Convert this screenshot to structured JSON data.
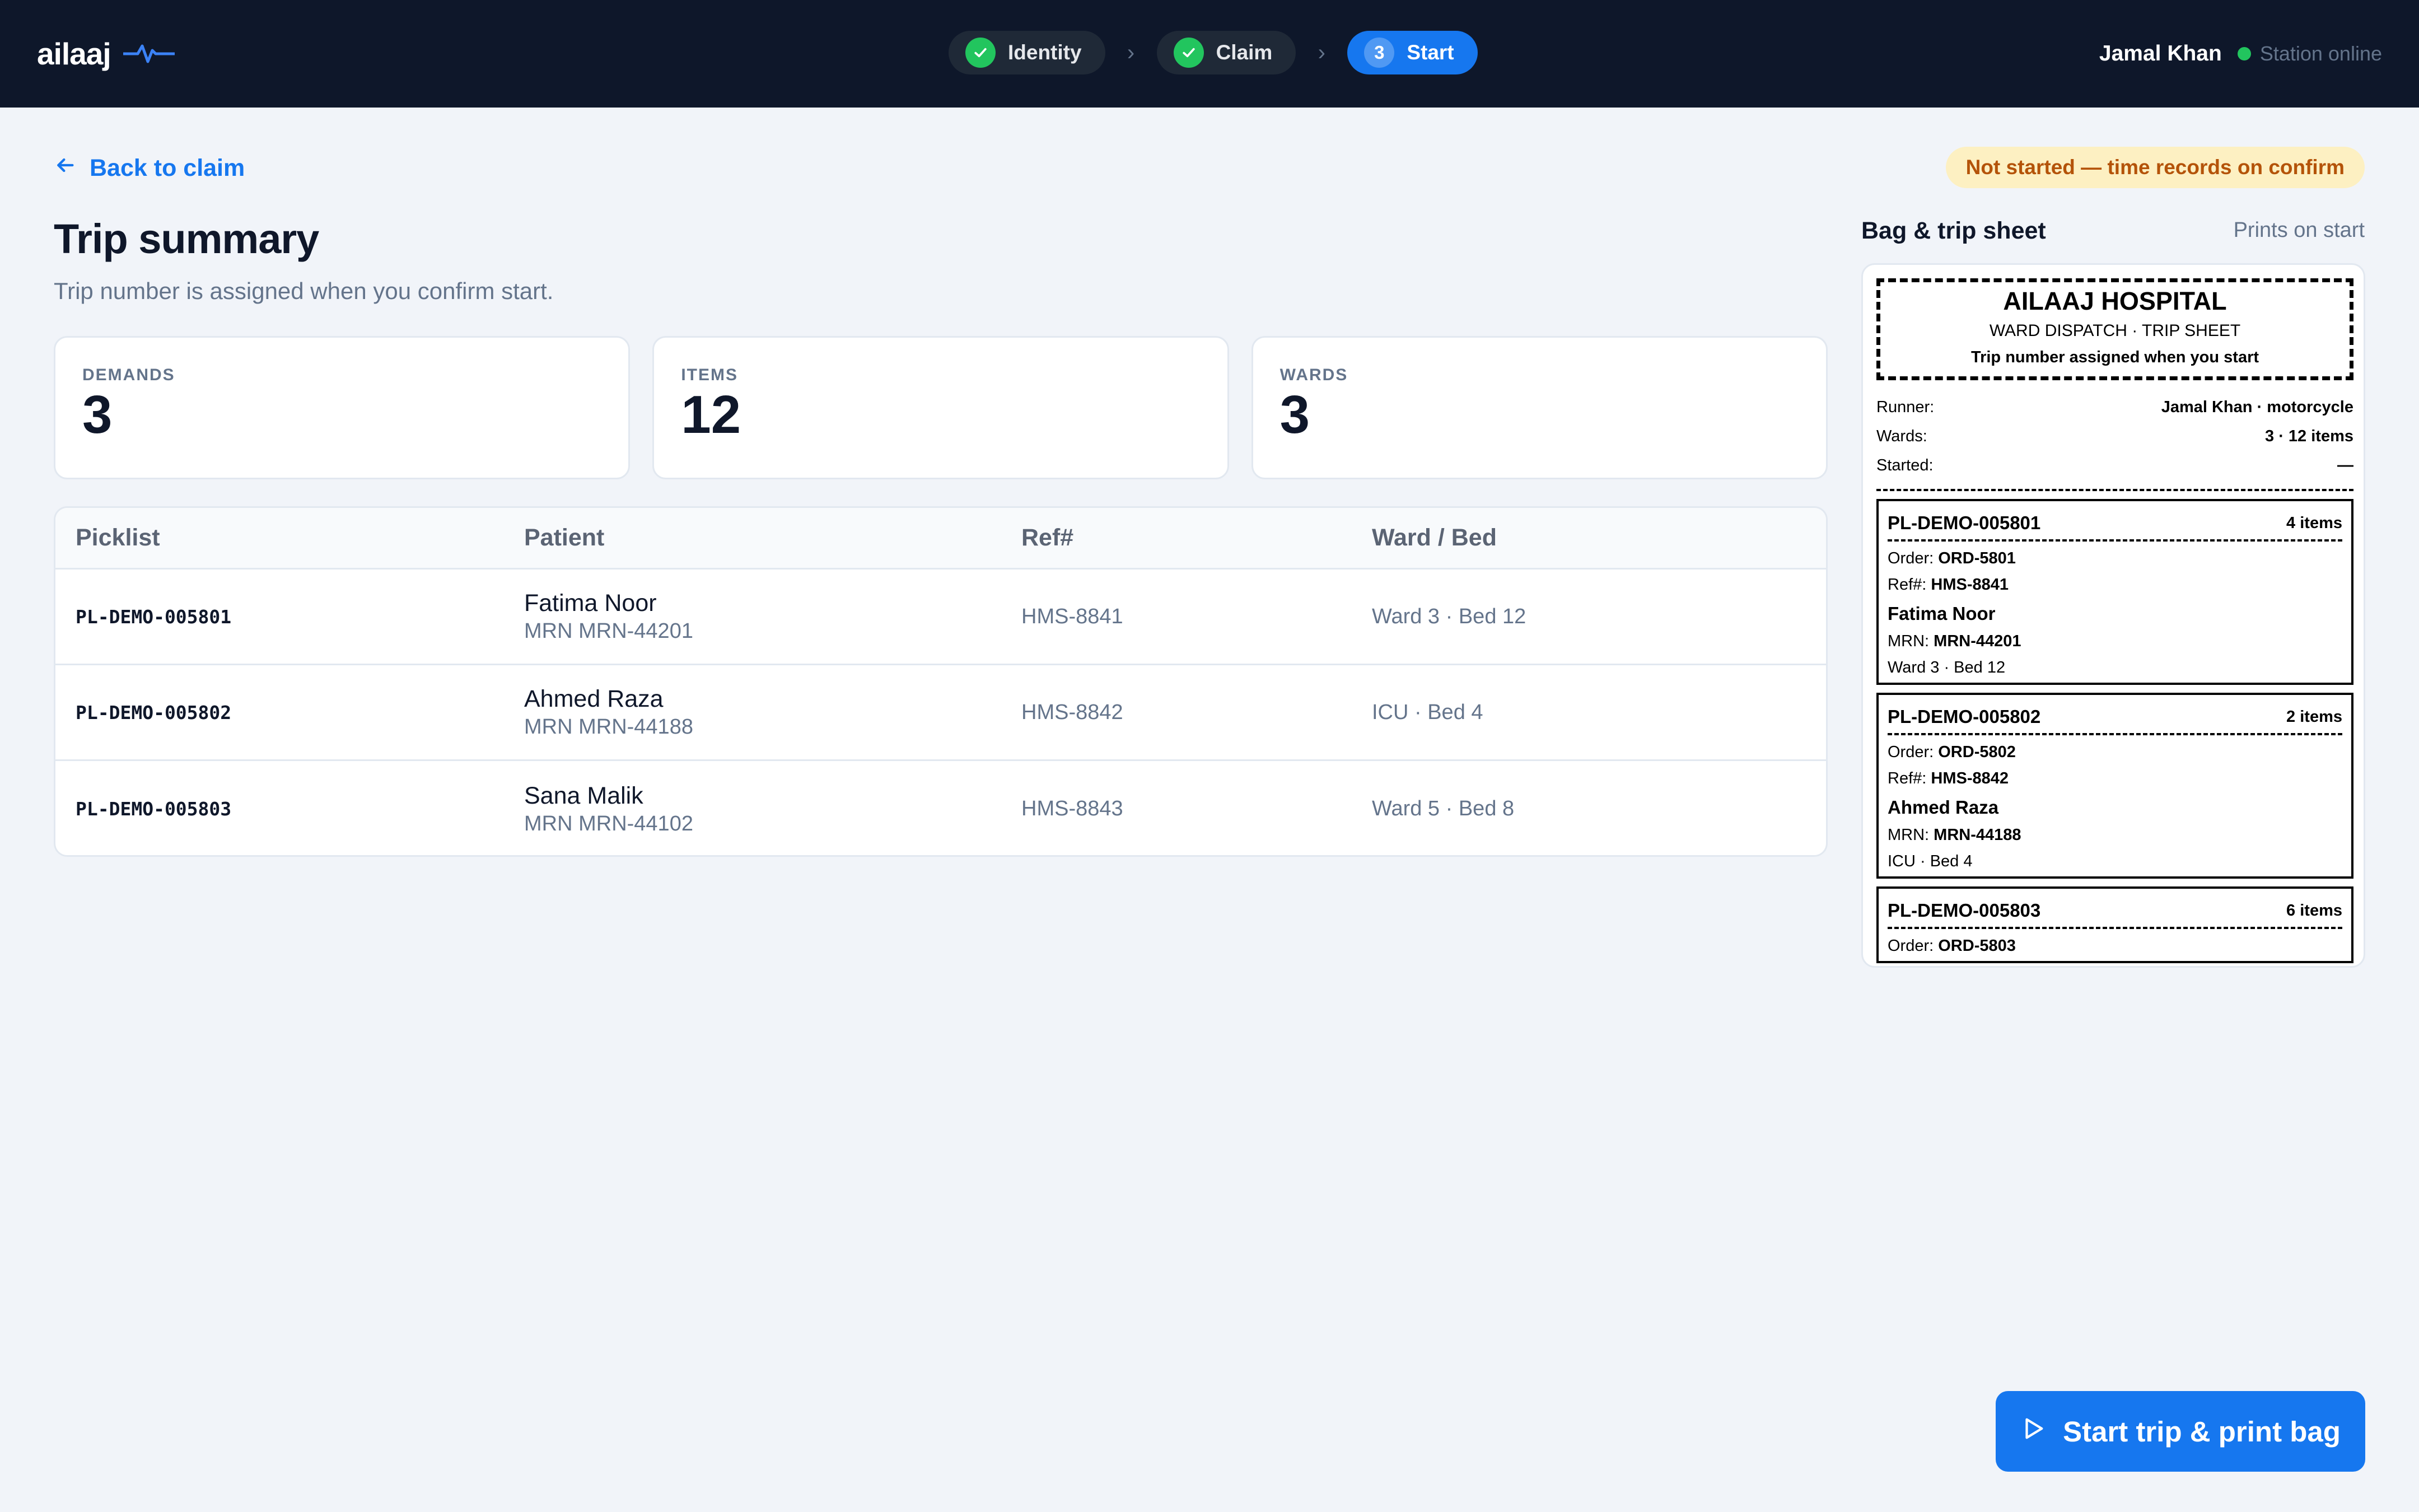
{
  "app": {
    "brand": "ailaaj"
  },
  "stepper": {
    "steps": [
      {
        "label": "Identity",
        "state": "done"
      },
      {
        "label": "Claim",
        "state": "done"
      },
      {
        "label": "Start",
        "state": "active",
        "number": "3"
      }
    ]
  },
  "user": {
    "name": "Jamal Khan",
    "station_status": "Station online"
  },
  "nav": {
    "back_label": "Back to claim"
  },
  "status_badge": "Not started — time records on confirm",
  "page": {
    "title": "Trip summary",
    "subtitle": "Trip number is assigned when you confirm start."
  },
  "stats": [
    {
      "label": "DEMANDS",
      "value": "3"
    },
    {
      "label": "ITEMS",
      "value": "12"
    },
    {
      "label": "WARDS",
      "value": "3"
    }
  ],
  "table": {
    "headers": [
      "Picklist",
      "Patient",
      "Ref#",
      "Ward / Bed"
    ],
    "rows": [
      {
        "picklist": "PL-DEMO-005801",
        "patient": "Fatima Noor",
        "mrn": "MRN MRN-44201",
        "ref": "HMS-8841",
        "ward": "Ward 3 · Bed 12"
      },
      {
        "picklist": "PL-DEMO-005802",
        "patient": "Ahmed Raza",
        "mrn": "MRN MRN-44188",
        "ref": "HMS-8842",
        "ward": "ICU · Bed 4"
      },
      {
        "picklist": "PL-DEMO-005803",
        "patient": "Sana Malik",
        "mrn": "MRN MRN-44102",
        "ref": "HMS-8843",
        "ward": "Ward 5 · Bed 8"
      }
    ]
  },
  "sheet": {
    "title": "Bag & trip sheet",
    "hint": "Prints on start",
    "hospital": "AILAAJ HOSPITAL",
    "subtitle": "WARD DISPATCH · TRIP SHEET",
    "note": "Trip number assigned when you start",
    "meta": [
      {
        "label": "Runner:",
        "value": "Jamal Khan · motorcycle"
      },
      {
        "label": "Wards:",
        "value": "3 · 12 items"
      },
      {
        "label": "Started:",
        "value": "—"
      }
    ],
    "picklists": [
      {
        "id": "PL-DEMO-005801",
        "count": "4 items",
        "order_label": "Order:",
        "order": "ORD-5801",
        "ref_label": "Ref#:",
        "ref": "HMS-8841",
        "patient": "Fatima Noor",
        "mrn_label": "MRN:",
        "mrn": "MRN-44201",
        "ward": "Ward 3 · Bed 12"
      },
      {
        "id": "PL-DEMO-005802",
        "count": "2 items",
        "order_label": "Order:",
        "order": "ORD-5802",
        "ref_label": "Ref#:",
        "ref": "HMS-8842",
        "patient": "Ahmed Raza",
        "mrn_label": "MRN:",
        "mrn": "MRN-44188",
        "ward": "ICU · Bed 4"
      },
      {
        "id": "PL-DEMO-005803",
        "count": "6 items",
        "order_label": "Order:",
        "order": "ORD-5803"
      }
    ]
  },
  "cta": {
    "label": "Start trip & print bag"
  },
  "colors": {
    "header_bg": "#0e172a",
    "accent": "#1677ef",
    "success": "#22c55e",
    "warning_bg": "#fdf0c2",
    "warning_text": "#b45309"
  },
  "icons": [
    "pulse-icon",
    "check-icon",
    "chevron-right-icon",
    "online-dot-icon",
    "arrow-left-icon",
    "play-icon"
  ]
}
